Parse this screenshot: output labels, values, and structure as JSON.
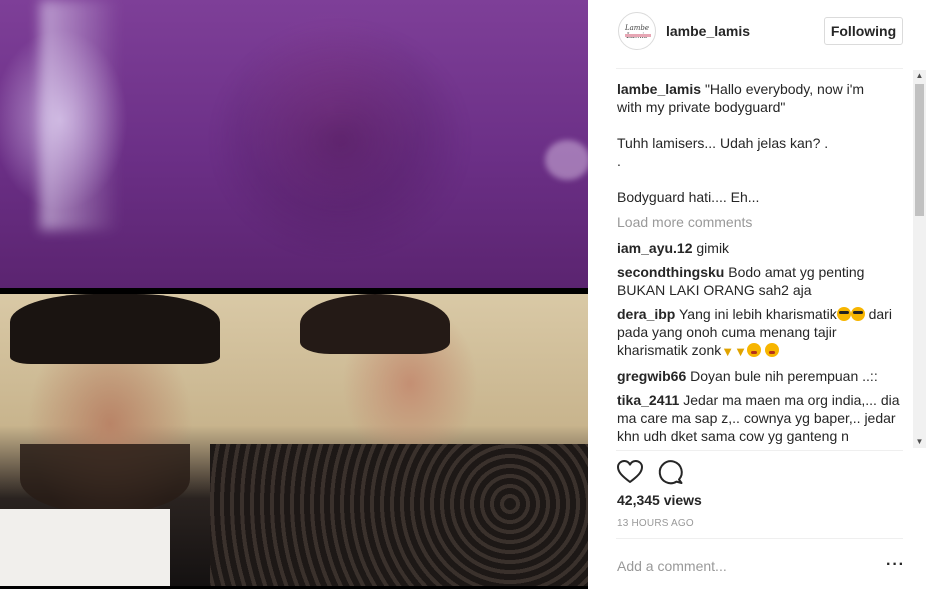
{
  "post": {
    "username": "lambe_lamis",
    "follow_label": "Following",
    "avatar_logo_text": "Lambe Lamis"
  },
  "caption": {
    "username": "lambe_lamis",
    "line1": "\"Hallo everybody, now i'm",
    "line2": "with my private bodyguard\"",
    "line3": "Tuhh lamisers... Udah jelas kan? .",
    "line4": ".",
    "line5": "Bodyguard hati.... Eh..."
  },
  "load_more_label": "Load more comments",
  "comments": [
    {
      "user": "iam_ayu.12",
      "text": "gimik"
    },
    {
      "user": "secondthingsku",
      "text": "Bodo amat yg penting BUKAN LAKI ORANG sah2 aja"
    },
    {
      "user": "dera_ibp",
      "text": "Yang ini lebih kharismatik",
      "text2": "dari pada yang onoh cuma menang tajir kharismatik zonk"
    },
    {
      "user": "gregwib66",
      "text": "Doyan bule nih perempuan ..::"
    },
    {
      "user": "tika_2411",
      "text": "Jedar ma maen ma org india,... dia ma care ma sap z,.. cownya yg baper,.. jedar khn udh dket sama cow yg ganteng n"
    }
  ],
  "icons": {
    "like": "heart-icon",
    "comment": "comment-bubble-icon",
    "more": "more-options-icon"
  },
  "stats": {
    "views": "42,345 views",
    "timestamp": "13 HOURS AGO"
  },
  "add_comment": {
    "placeholder": "Add a comment...",
    "more_label": "···"
  },
  "colors": {
    "secondary_text": "#999999",
    "border": "#efefef",
    "media_top_tint": "#6b2f86"
  }
}
